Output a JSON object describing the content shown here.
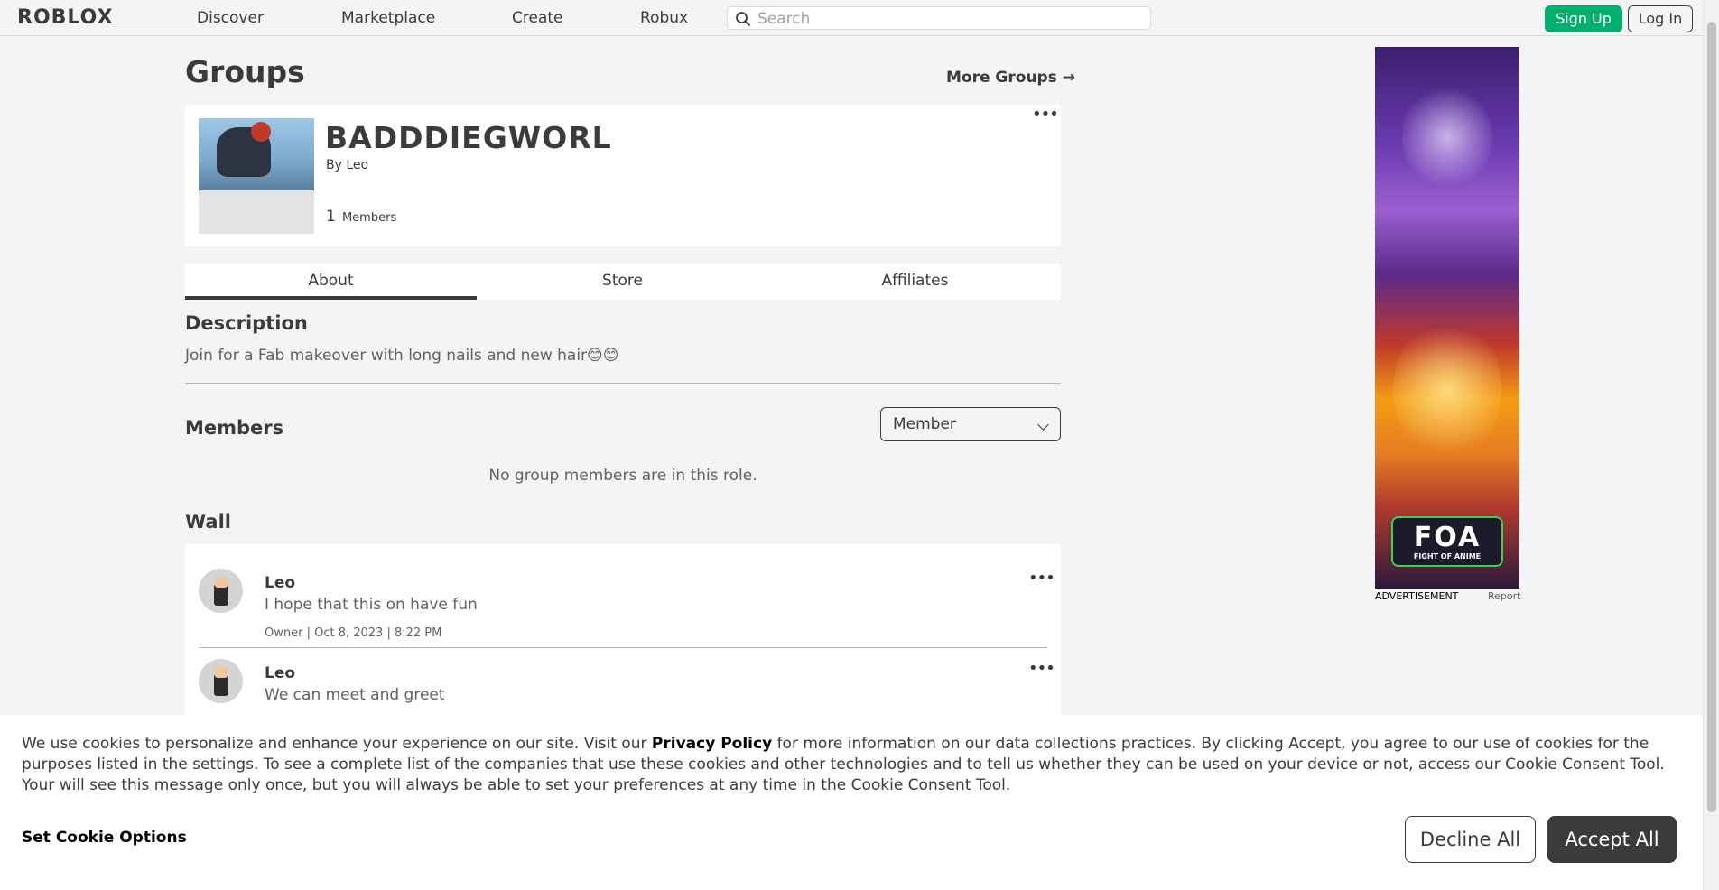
{
  "header": {
    "logo": "ROBLOX",
    "nav": [
      "Discover",
      "Marketplace",
      "Create",
      "Robux"
    ],
    "search_placeholder": "Search",
    "signup_label": "Sign Up",
    "login_label": "Log In"
  },
  "page": {
    "title": "Groups",
    "more_groups": "More Groups →"
  },
  "group": {
    "name": "BADDDIEGWORL",
    "by_prefix": "By",
    "owner": "Leo",
    "member_count": "1",
    "members_label": "Members",
    "menu_icon": "more-dots-icon"
  },
  "tabs": [
    "About",
    "Store",
    "Affiliates"
  ],
  "active_tab": "About",
  "description": {
    "heading": "Description",
    "text": "Join for a Fab makeover with long nails and new hair😊😊"
  },
  "members": {
    "heading": "Members",
    "role_selected": "Member",
    "empty_text": "No group members are in this role."
  },
  "wall": {
    "heading": "Wall",
    "posts": [
      {
        "author": "Leo",
        "message": "I hope that this on have fun",
        "meta": "Owner | Oct 8, 2023 | 8:22 PM"
      },
      {
        "author": "Leo",
        "message": "We can meet and greet",
        "meta": ""
      }
    ]
  },
  "ad": {
    "logo_text": "FOA",
    "logo_subtitle": "FIGHT OF ANIME",
    "label": "ADVERTISEMENT",
    "report": "Report"
  },
  "cookie_banner": {
    "text_before": "We use cookies to personalize and enhance your experience on our site. Visit our ",
    "privacy_link": "Privacy Policy",
    "text_after": " for more information on our data collections practices. By clicking Accept, you agree to our use of cookies for the purposes listed in the settings. To see a complete list of the companies that use these cookies and other technologies and to tell us whether they can be used on your device or not, access our Cookie Consent Tool. Your will see this message only once, but you will always be able to set your preferences at any time in the Cookie Consent Tool.",
    "options_label": "Set Cookie Options",
    "decline_label": "Decline All",
    "accept_label": "Accept All"
  },
  "colors": {
    "signup_green": "#00b06f",
    "text_dark": "#393b3d",
    "page_bg": "#f2f4f5"
  }
}
